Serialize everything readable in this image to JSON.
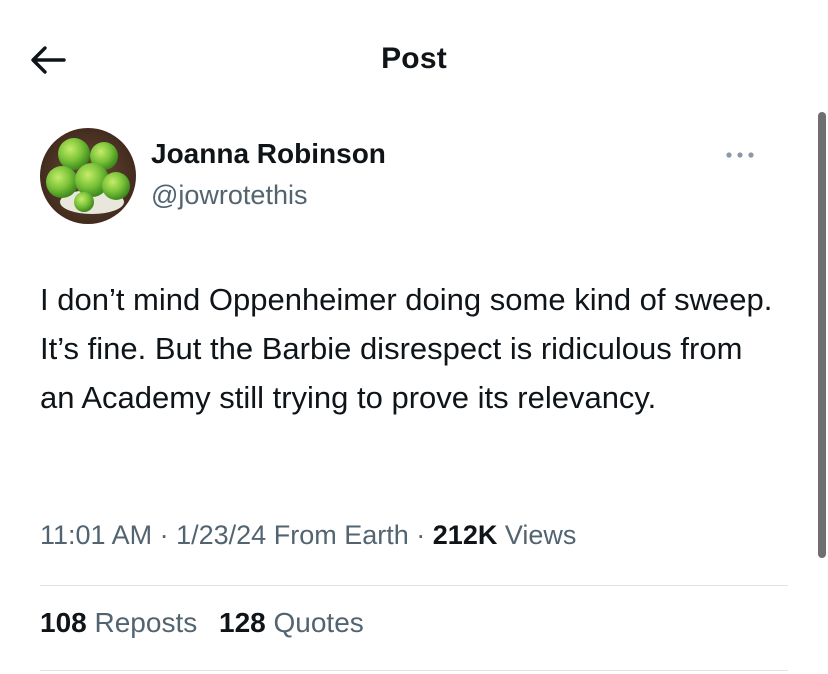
{
  "header": {
    "title": "Post",
    "back_icon": "arrow-left-icon"
  },
  "author": {
    "name": "Joanna Robinson",
    "handle": "@jowrotethis",
    "avatar_icon": "green-apples-avatar",
    "more_icon": "more-horizontal-icon"
  },
  "post": {
    "text": "I don’t mind Oppenheimer doing some kind of sweep. It’s fine. But the Barbie disrespect is ridiculous from an Academy still trying to prove its relevancy.",
    "time": "11:01 AM",
    "separator": "·",
    "date": "1/23/24",
    "source": "From Earth",
    "views_count": "212K",
    "views_label": "Views"
  },
  "stats": {
    "reposts_count": "108",
    "reposts_label": "Reposts",
    "quotes_count": "128",
    "quotes_label": "Quotes"
  },
  "colors": {
    "text_primary": "#0f1419",
    "text_secondary": "#536471",
    "divider": "#dfe3e6",
    "background": "#ffffff"
  }
}
